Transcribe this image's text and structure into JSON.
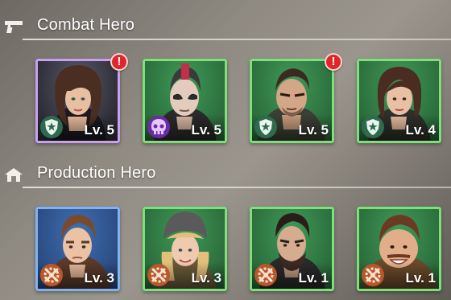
{
  "sections": {
    "combat": {
      "title": "Combat Hero",
      "heroes": [
        {
          "level": "Lv. 5",
          "rarity": "purple",
          "class_icon": "shield-icon",
          "alert": "!"
        },
        {
          "level": "Lv. 5",
          "rarity": "green",
          "class_icon": "skull-icon",
          "alert": null
        },
        {
          "level": "Lv. 5",
          "rarity": "green",
          "class_icon": "shield-icon",
          "alert": "!"
        },
        {
          "level": "Lv. 4",
          "rarity": "green",
          "class_icon": "shield-icon",
          "alert": null
        }
      ]
    },
    "production": {
      "title": "Production Hero",
      "heroes": [
        {
          "level": "Lv. 3",
          "rarity": "blue",
          "class_icon": "gear-wrench-icon"
        },
        {
          "level": "Lv. 3",
          "rarity": "green",
          "class_icon": "gear-wrench-icon"
        },
        {
          "level": "Lv. 1",
          "rarity": "green",
          "class_icon": "gear-wrench-icon"
        },
        {
          "level": "Lv. 1",
          "rarity": "green",
          "class_icon": "gear-wrench-icon"
        }
      ]
    }
  },
  "colors": {
    "purple_frame": "#c9a0f0",
    "green_frame": "#7ee07a",
    "blue_frame": "#7fb2f0",
    "alert_red": "#e0262a"
  }
}
